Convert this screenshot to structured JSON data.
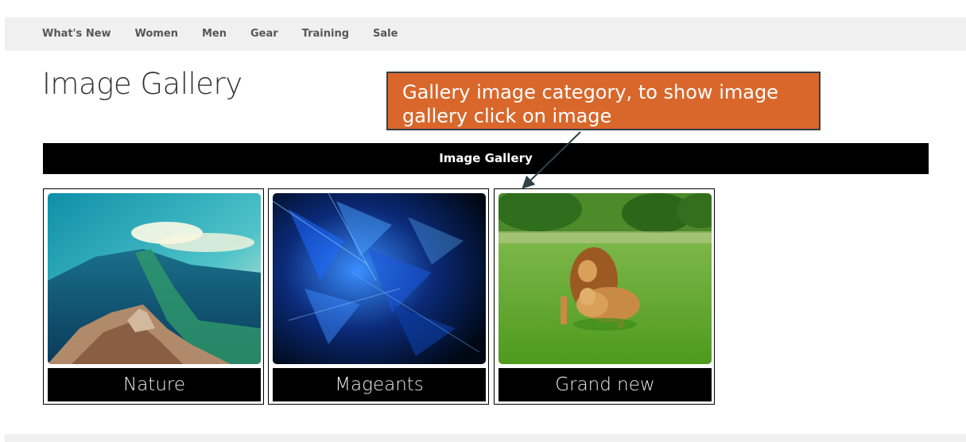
{
  "nav": {
    "items": [
      "What's New",
      "Women",
      "Men",
      "Gear",
      "Training",
      "Sale"
    ]
  },
  "page_title": "Image Gallery",
  "gallery_header": "Image Gallery",
  "categories": [
    {
      "label": "Nature"
    },
    {
      "label": "Mageants"
    },
    {
      "label": "Grand new"
    }
  ],
  "callout": {
    "text": "Gallery image category, to show image gallery click on image"
  },
  "colors": {
    "callout_bg": "#d9672b",
    "header_bg": "#000000",
    "nav_bg": "#f0f0f0"
  }
}
